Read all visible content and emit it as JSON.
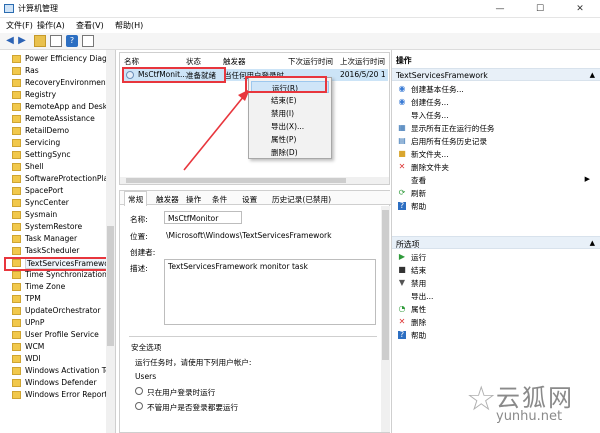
{
  "window": {
    "title": "计算机管理",
    "minimize": "—",
    "maximize": "☐",
    "close": "✕"
  },
  "menu": [
    "文件(F)",
    "操作(A)",
    "查看(V)",
    "帮助(H)"
  ],
  "tree": {
    "items": [
      "Power Efficiency Diagn",
      "Ras",
      "RecoveryEnvironment",
      "Registry",
      "RemoteApp and Desk",
      "RemoteAssistance",
      "RetailDemo",
      "Servicing",
      "SettingSync",
      "Shell",
      "SoftwareProtectionPlat",
      "SpacePort",
      "SyncCenter",
      "Sysmain",
      "SystemRestore",
      "Task Manager",
      "TaskScheduler",
      "TextServicesFramewor",
      "Time Synchronization",
      "Time Zone",
      "TPM",
      "UpdateOrchestrator",
      "UPnP",
      "User Profile Service",
      "WCM",
      "WDI",
      "Windows Activation Te",
      "Windows Defender",
      "Windows Error Report"
    ],
    "selected_index": 17
  },
  "list": {
    "columns": [
      "名称",
      "状态",
      "触发器",
      "下次运行时间",
      "上次运行时间"
    ],
    "row": {
      "name": "MsCtfMonit...",
      "status": "准备就绪",
      "trigger": "当任何用户登录时",
      "next_run": "",
      "last_run": "2016/5/20 1"
    }
  },
  "context_menu": {
    "items": [
      "运行(R)",
      "结束(E)",
      "禁用(I)",
      "导出(X)...",
      "属性(P)",
      "删除(D)"
    ],
    "highlighted_index": 0
  },
  "detail": {
    "tabs": [
      "常规",
      "触发器",
      "操作",
      "条件",
      "设置",
      "历史记录(已禁用)"
    ],
    "active_tab": 0,
    "name_label": "名称:",
    "name_value": "MsCtfMonitor",
    "location_label": "位置:",
    "location_value": "\\Microsoft\\Windows\\TextServicesFramework",
    "author_label": "创建者:",
    "description_label": "描述:",
    "description_value": "TextServicesFramework monitor task",
    "security_title": "安全选项",
    "run_as_label": "运行任务时，请使用下列用户帐户:",
    "run_as_value": "Users",
    "option_1": "只在用户登录时运行",
    "option_2": "不管用户是否登录都要运行"
  },
  "actions": {
    "header": "操作",
    "group1_title": "TextServicesFramework",
    "group1": [
      {
        "icon": "create-basic-task-icon",
        "label": "创建基本任务..."
      },
      {
        "icon": "create-task-icon",
        "label": "创建任务..."
      },
      {
        "icon": "",
        "label": "导入任务..."
      },
      {
        "icon": "running-tasks-icon",
        "label": "显示所有正在运行的任务"
      },
      {
        "icon": "history-icon",
        "label": "启用所有任务历史记录"
      },
      {
        "icon": "new-folder-icon",
        "label": "新文件夹..."
      },
      {
        "icon": "delete-folder-icon",
        "label": "删除文件夹"
      },
      {
        "icon": "",
        "label": "查看"
      },
      {
        "icon": "refresh-icon",
        "label": "刷新"
      },
      {
        "icon": "help-icon",
        "label": "帮助"
      }
    ],
    "group2_title": "所选项",
    "group2": [
      {
        "icon": "run-icon",
        "label": "运行"
      },
      {
        "icon": "end-icon",
        "label": "结束"
      },
      {
        "icon": "disable-icon",
        "label": "禁用"
      },
      {
        "icon": "",
        "label": "导出..."
      },
      {
        "icon": "properties-icon",
        "label": "属性"
      },
      {
        "icon": "delete-icon",
        "label": "删除"
      },
      {
        "icon": "help-icon",
        "label": "帮助"
      }
    ]
  },
  "watermark": {
    "cn": "云狐网",
    "en": "yunhu.net"
  },
  "colors": {
    "highlight_red": "#e8363d",
    "selection_blue": "#cce4f7",
    "group_header": "#e8f0f8"
  }
}
